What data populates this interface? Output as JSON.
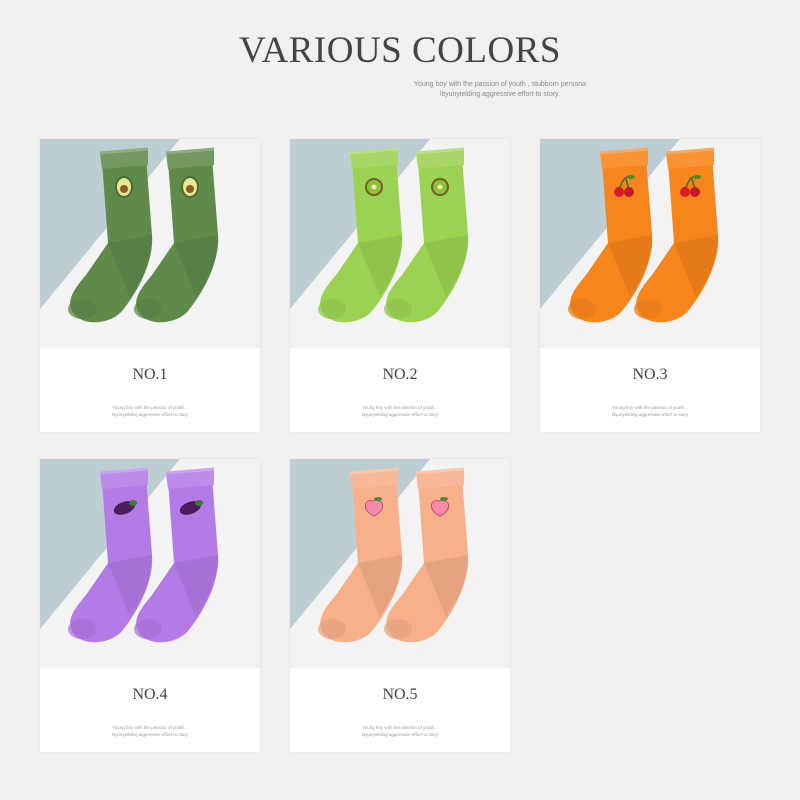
{
  "header": {
    "title": "VARIOUS COLORS",
    "subtitle_line1": "Young boy with the passion of youth , stubborn persona",
    "subtitle_line2": "lityunyielding aggressive effort to story."
  },
  "cards": [
    {
      "label": "NO.1",
      "sock_color": "#5f8a4a",
      "icon": "avocado-icon",
      "caption_line1": "Young boy with the passion of youth...",
      "caption_line2": "lityunyielding aggressive effort to story"
    },
    {
      "label": "NO.2",
      "sock_color": "#9cd252",
      "icon": "kiwi-icon",
      "caption_line1": "Young boy with the passion of youth...",
      "caption_line2": "lityunyielding aggressive effort to story"
    },
    {
      "label": "NO.3",
      "sock_color": "#f7851b",
      "icon": "cherry-icon",
      "caption_line1": "Young boy with the passion of youth...",
      "caption_line2": "lityunyielding aggressive effort to story"
    },
    {
      "label": "NO.4",
      "sock_color": "#b47be6",
      "icon": "eggplant-icon",
      "caption_line1": "Young boy with the passion of youth...",
      "caption_line2": "lityunyielding aggressive effort to story"
    },
    {
      "label": "NO.5",
      "sock_color": "#f7b08a",
      "icon": "peach-icon",
      "caption_line1": "Young boy with the passion of youth...",
      "caption_line2": "lityunyielding aggressive effort to story"
    }
  ],
  "colors": {
    "background": "#f1f0ef",
    "photo_bg_light": "#f3f3f3",
    "photo_bg_blue": "#a9c2c6"
  }
}
